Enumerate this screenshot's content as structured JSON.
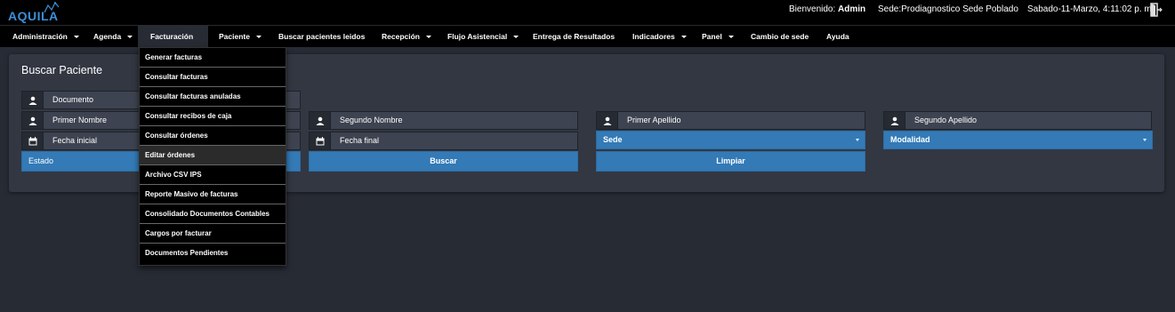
{
  "app": {
    "logo_text": "AQUILA"
  },
  "header": {
    "welcome_label": "Bienvenido:",
    "user": "Admin",
    "sede": "Sede:Prodiagnostico Sede Poblado",
    "datetime": "Sabado-11-Marzo, 4:11:02 p. m.",
    "exit_icon": "exit-door-icon"
  },
  "nav": [
    {
      "label": "Administración",
      "caret": true
    },
    {
      "label": "Agenda",
      "caret": true
    },
    {
      "label": "Facturación",
      "caret": false,
      "active": true
    },
    {
      "label": "Paciente",
      "caret": true
    },
    {
      "label": "Buscar pacientes leidos",
      "caret": false
    },
    {
      "label": "Recepción",
      "caret": true
    },
    {
      "label": "Flujo Asistencial",
      "caret": true
    },
    {
      "label": "Entrega de Resultados",
      "caret": false
    },
    {
      "label": "Indicadores",
      "caret": true
    },
    {
      "label": "Panel",
      "caret": true
    },
    {
      "label": "Cambio de sede",
      "caret": false
    },
    {
      "label": "Ayuda",
      "caret": false
    }
  ],
  "dropdown": [
    "Generar facturas",
    "Consultar facturas",
    "Consultar facturas anuladas",
    "Consultar recibos de caja",
    "Consultar órdenes",
    "Editar órdenes",
    "Archivo CSV IPS",
    "Reporte Masivo de facturas",
    "Consolidado Documentos Contables",
    "Cargos por facturar",
    "Documentos Pendientes"
  ],
  "panel": {
    "title": "Buscar Paciente",
    "documento_placeholder": "Documento",
    "primer_nombre_placeholder": "Primer Nombre",
    "segundo_nombre_placeholder": "Segundo Nombre",
    "primer_apellido_placeholder": "Primer Apellido",
    "segundo_apellido_placeholder": "Segundo Apellido",
    "fecha_inicial_placeholder": "Fecha inicial",
    "fecha_final_placeholder": "Fecha final",
    "sede_select": "Sede",
    "modalidad_select": "Modalidad",
    "estado_select": "Estado",
    "buscar_label": "Buscar",
    "limpiar_label": "Limpiar"
  },
  "colors": {
    "accent": "#337ab7",
    "background": "#272b34",
    "panel": "#323742",
    "logo": "#3d8fd8"
  }
}
